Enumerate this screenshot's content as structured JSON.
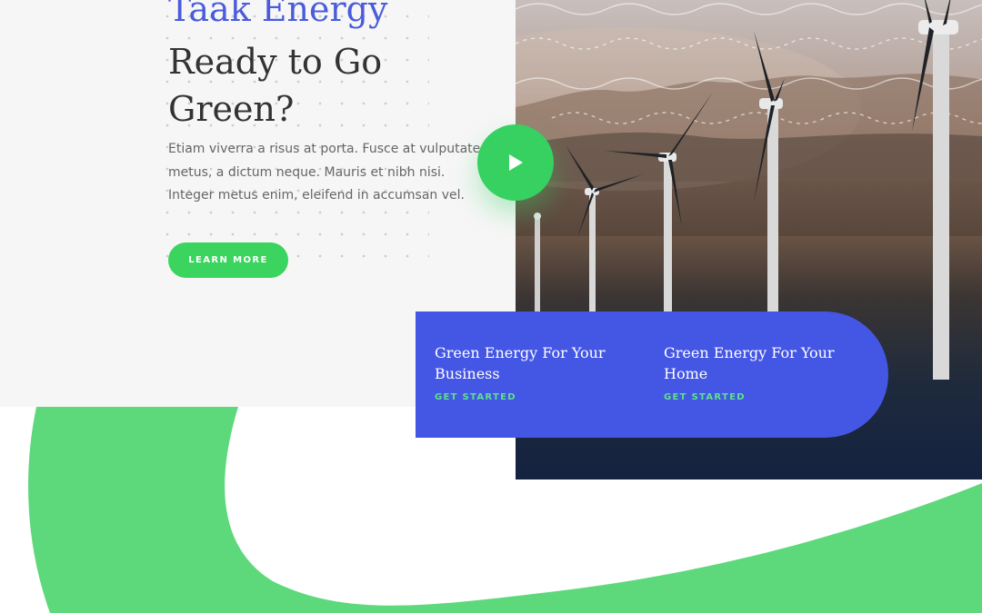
{
  "hero": {
    "brand": "Taak Energy",
    "headline": "Ready to Go Green?",
    "body": "Etiam viverra a risus at porta. Fusce at vulputate metus, a dictum neque. Mauris et nibh nisi. Integer metus enim, eleifend in accumsan vel.",
    "button_label": "LEARN MORE"
  },
  "video": {
    "icon": "play-icon"
  },
  "cards": [
    {
      "title": "Green Energy For Your Business",
      "link": "GET STARTED"
    },
    {
      "title": "Green Energy For Your Home",
      "link": "GET STARTED"
    }
  ],
  "colors": {
    "brand_blue": "#4a5bdc",
    "card_blue": "#4456e4",
    "accent_green": "#3ad45e",
    "swoosh_green": "#5dd97c",
    "link_green": "#5fe08d",
    "hero_bg": "#f6f6f6"
  }
}
